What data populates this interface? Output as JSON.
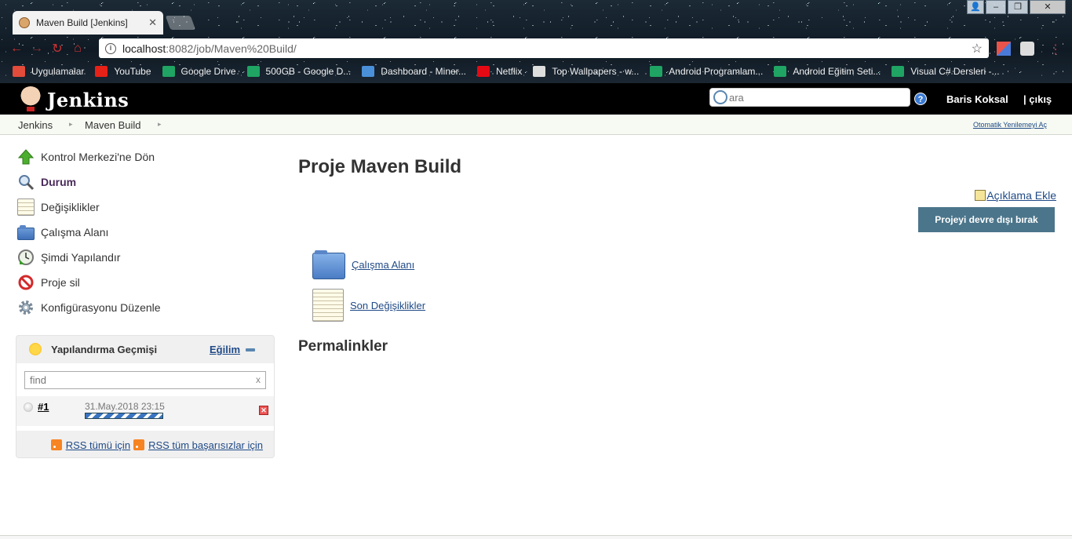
{
  "browser": {
    "tab_title": "Maven Build [Jenkins]",
    "url_host": "localhost",
    "url_path": ":8082/job/Maven%20Build/",
    "bookmarks": [
      {
        "label": "Uygulamalar",
        "color": "#e34b3b"
      },
      {
        "label": "YouTube",
        "color": "#e62117"
      },
      {
        "label": "Google Drive",
        "color": "#1fa463"
      },
      {
        "label": "500GB - Google D...",
        "color": "#1fa463"
      },
      {
        "label": "Dashboard - Miner...",
        "color": "#4a90d9"
      },
      {
        "label": "Netflix",
        "color": "#e50914"
      },
      {
        "label": "Top Wallpapers - w...",
        "color": "#dddddd"
      },
      {
        "label": "Android Programlam...",
        "color": "#1fa463"
      },
      {
        "label": "Android Eğitim Seti...",
        "color": "#1fa463"
      },
      {
        "label": "Visual C# Dersleri -...",
        "color": "#1fa463"
      }
    ]
  },
  "header": {
    "logo_text": "Jenkins",
    "search_placeholder": "ara",
    "help_label": "?",
    "user_name": "Baris Koksal",
    "logout_label": "| çıkış"
  },
  "breadcrumb": {
    "items": [
      "Jenkins",
      "Maven Build"
    ],
    "auto_refresh_label": "Otomatik Yenilemeyi Aç"
  },
  "sidebar": {
    "tasks": [
      {
        "label": "Kontrol Merkezi'ne Dön",
        "icon": "up-arrow-icon"
      },
      {
        "label": "Durum",
        "icon": "search-icon"
      },
      {
        "label": "Değişiklikler",
        "icon": "notepad-icon"
      },
      {
        "label": "Çalışma Alanı",
        "icon": "folder-icon"
      },
      {
        "label": "Şimdi Yapılandır",
        "icon": "clock-icon"
      },
      {
        "label": "Proje sil",
        "icon": "no-entry-icon"
      },
      {
        "label": "Konfigürasyonu Düzenle",
        "icon": "gear-icon"
      }
    ]
  },
  "build_history": {
    "title": "Yapılandırma Geçmişi",
    "trend_label": "Eğilim",
    "find_placeholder": "find",
    "clear_label": "x",
    "builds": [
      {
        "number": "#1",
        "date": "31.May.2018 23:15"
      }
    ],
    "rss_all_label": "RSS tümü için",
    "rss_failed_label": "RSS tüm başarısızlar için"
  },
  "main": {
    "title": "Proje Maven Build",
    "add_description_label": "Açıklama Ekle",
    "disable_button_label": "Projeyi devre dışı bırak",
    "links": [
      {
        "label": "Çalışma Alanı",
        "icon": "folder-icon"
      },
      {
        "label": "Son Değişiklikler",
        "icon": "notepad-icon"
      }
    ],
    "permalinks_heading": "Permalinkler"
  }
}
